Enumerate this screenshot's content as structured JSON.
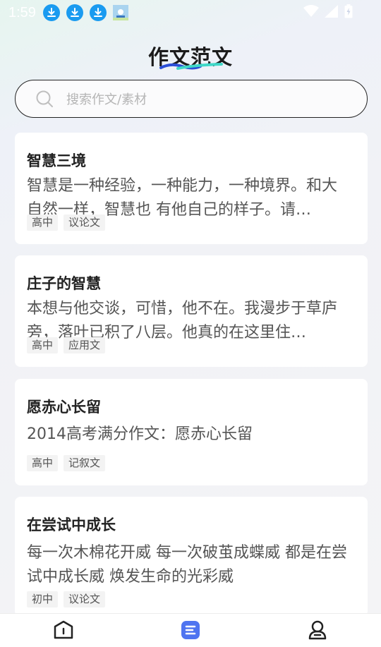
{
  "status_bar": {
    "time": "1:59",
    "notification_icons": [
      "download-icon",
      "download-icon",
      "download-icon",
      "app-thumbnail-icon"
    ],
    "system_icons": [
      "wifi-icon",
      "signal-icon",
      "battery-icon"
    ]
  },
  "header": {
    "title": "作文范文"
  },
  "search": {
    "placeholder": "搜索作文/素材"
  },
  "articles": [
    {
      "title": "智慧三境",
      "excerpt": "智慧是一种经验，一种能力，一种境界。和大自然一样，智慧也 有他自己的样子。请…",
      "tags": [
        "高中",
        "议论文"
      ]
    },
    {
      "title": "庄子的智慧",
      "excerpt": "本想与他交谈，可惜，他不在。我漫步于草庐旁，落叶已积了八层。他真的在这里住…",
      "tags": [
        "高中",
        "应用文"
      ]
    },
    {
      "title": "愿赤心长留",
      "excerpt": "2014高考满分作文：愿赤心长留",
      "tags": [
        "高中",
        "记叙文"
      ]
    },
    {
      "title": "在尝试中成长",
      "excerpt": "每一次木棉花开威 每一次破茧成蝶威 都是在尝试中成长威 焕发生命的光彩威",
      "tags": [
        "初中",
        "议论文"
      ]
    }
  ],
  "tab_bar": {
    "tabs": [
      "home-icon",
      "essay-list-icon",
      "profile-icon"
    ],
    "active_color": "#4f74f0"
  }
}
